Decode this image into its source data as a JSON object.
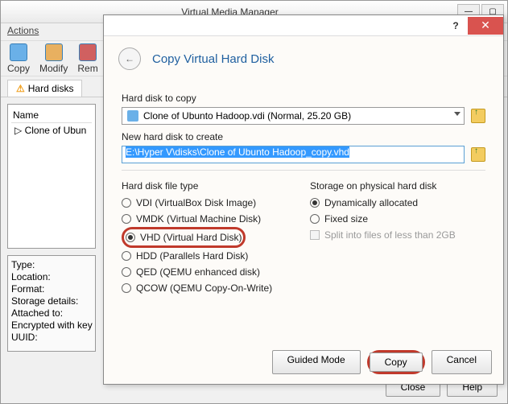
{
  "main": {
    "title": "Virtual Media Manager",
    "menu": "Actions",
    "toolbar": {
      "copy": "Copy",
      "modify": "Modify",
      "remove": "Rem"
    },
    "tab": "Hard disks",
    "list": {
      "header": "Name",
      "item": "Clone of Ubun"
    },
    "details": {
      "type": "Type:",
      "location": "Location:",
      "format": "Format:",
      "storage": "Storage details:",
      "attached": "Attached to:",
      "encrypted": "Encrypted with key",
      "uuid": "UUID:"
    },
    "buttons": {
      "close": "Close",
      "help": "Help"
    }
  },
  "wizard": {
    "title": "Copy Virtual Hard Disk",
    "labels": {
      "copy_src": "Hard disk to copy",
      "new_disk": "New hard disk to create",
      "file_type": "Hard disk file type",
      "storage": "Storage on physical hard disk"
    },
    "source_disk": "Clone of Ubunto Hadoop.vdi (Normal, 25.20 GB)",
    "new_path": "E:\\Hyper V\\disks\\Clone of Ubunto Hadoop_copy.vhd",
    "file_types": {
      "vdi": "VDI (VirtualBox Disk Image)",
      "vmdk": "VMDK (Virtual Machine Disk)",
      "vhd": "VHD (Virtual Hard Disk)",
      "hdd": "HDD (Parallels Hard Disk)",
      "qed": "QED (QEMU enhanced disk)",
      "qcow": "QCOW (QEMU Copy-On-Write)"
    },
    "storage_opts": {
      "dynamic": "Dynamically allocated",
      "fixed": "Fixed size",
      "split": "Split into files of less than 2GB"
    },
    "buttons": {
      "guided": "Guided Mode",
      "copy": "Copy",
      "cancel": "Cancel"
    },
    "help_symbol": "?",
    "close_symbol": "✕",
    "back_symbol": "←"
  }
}
